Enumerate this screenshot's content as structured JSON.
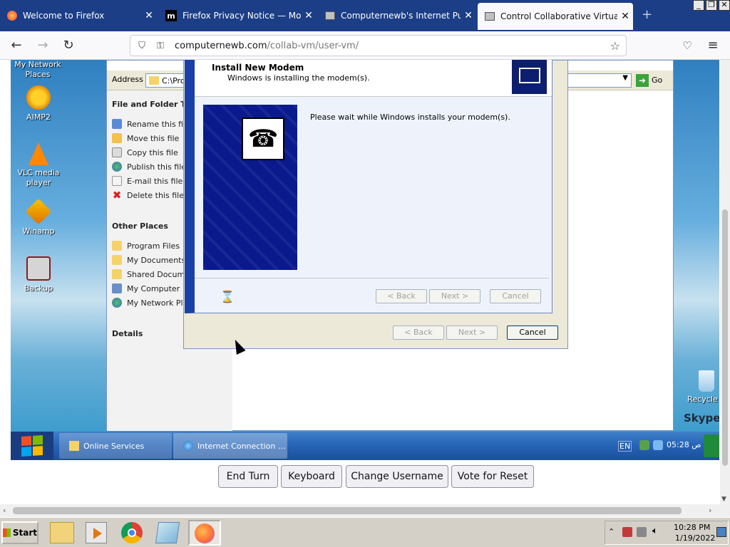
{
  "browser": {
    "tabs": [
      {
        "label": "Welcome to Firefox",
        "active": false
      },
      {
        "label": "Firefox Privacy Notice — Mozilla",
        "active": false
      },
      {
        "label": "Computernewb's Internet Pub Hub",
        "active": false
      },
      {
        "label": "Control Collaborative Virtual Machi",
        "active": true
      }
    ],
    "new_tab": "+",
    "url_domain": "computernewb.com",
    "url_path": "/collab-vm/user-vm/"
  },
  "vm_desktop": {
    "icons": [
      {
        "label": "My Network Places"
      },
      {
        "label": "AIMP2"
      },
      {
        "label": "VLC media player"
      },
      {
        "label": "Winamp"
      },
      {
        "label": "Backup"
      },
      {
        "label": "Recycle B"
      }
    ],
    "skype_text": "Skype"
  },
  "explorer": {
    "address_label": "Address",
    "address_value": "C:\\Prog",
    "go_label": "Go",
    "file_tasks_header": "File and Folder Tas",
    "file_tasks": [
      "Rename this file",
      "Move this file",
      "Copy this file",
      "Publish this file t",
      "E-mail this file",
      "Delete this file"
    ],
    "other_places_header": "Other Places",
    "other_places": [
      "Program Files",
      "My Documents",
      "Shared Documer",
      "My Computer",
      "My Network Plac"
    ],
    "details_header": "Details"
  },
  "install_modem_dialog": {
    "title": "Install New Modem",
    "subtitle": "Windows is installing the modem(s).",
    "message": "Please wait while Windows installs your modem(s).",
    "back": "< Back",
    "next": "Next >",
    "cancel": "Cancel"
  },
  "outer_dialog": {
    "back": "< Back",
    "next": "Next >",
    "cancel": "Cancel"
  },
  "vm_taskbar": {
    "tasks": [
      {
        "label": "Online Services"
      },
      {
        "label": "Internet Connection ..."
      }
    ],
    "lang": "EN",
    "clock": "05:28 ص"
  },
  "vm_controls": {
    "end_turn": "End Turn",
    "keyboard": "Keyboard",
    "change_username": "Change Username",
    "vote_for_reset": "Vote for Reset"
  },
  "host_taskbar": {
    "start_label": "Start",
    "time": "10:28 PM",
    "date": "1/19/2022"
  },
  "colors": {
    "browser_tab_bar": "#1c3e86",
    "xp_blue": "#1a3fa8",
    "vm_taskbar": "#2563b5"
  }
}
